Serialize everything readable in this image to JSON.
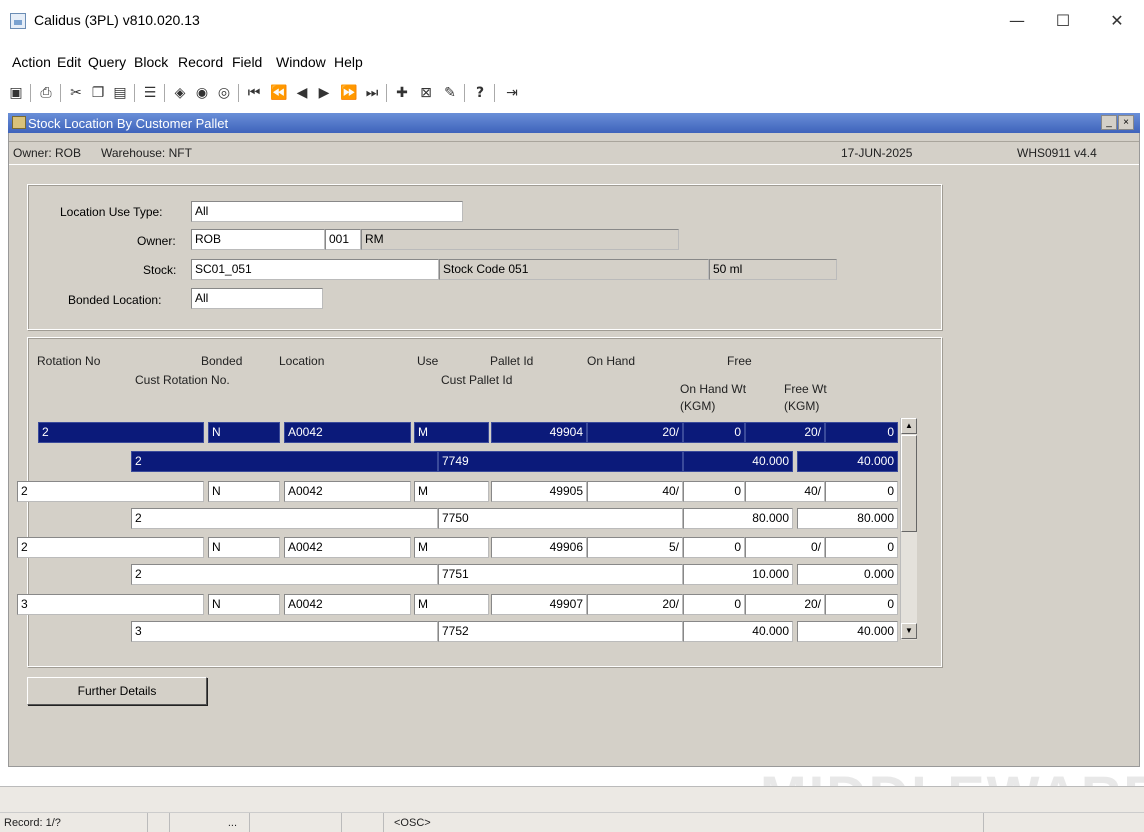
{
  "window": {
    "title": "Calidus (3PL) v810.020.13",
    "minimize": "—",
    "maximize": "☐",
    "close": "✕"
  },
  "menu": [
    {
      "label": "Action"
    },
    {
      "label": "Edit"
    },
    {
      "label": "Query"
    },
    {
      "label": "Block"
    },
    {
      "label": "Record"
    },
    {
      "label": "Field"
    },
    {
      "label": "Window"
    },
    {
      "label": "Help"
    }
  ],
  "toolbar_icons": [
    "save-icon",
    "print-icon",
    "cut-icon",
    "copy-icon",
    "paste-icon",
    "list-icon",
    "clear-block-icon",
    "clear-record-icon",
    "clear-field-icon",
    "first-record-icon",
    "prev-set-icon",
    "prev-record-icon",
    "next-record-icon",
    "next-set-icon",
    "last-record-icon",
    "insert-record-icon",
    "delete-record-icon",
    "duplicate-icon",
    "help-icon",
    "exit-icon"
  ],
  "form": {
    "title": "Stock Location By Customer Pallet",
    "owner_label": "Owner: ROB",
    "warehouse_label": "Warehouse: NFT",
    "date": "17-JUN-2025",
    "screen_id": "WHS0911 v4.4"
  },
  "criteria": {
    "location_use_type_label": "Location Use Type:",
    "location_use_type": "All",
    "owner_label": "Owner:",
    "owner": "ROB",
    "owner_code": "001",
    "owner_name": "RM",
    "stock_label": "Stock:",
    "stock": "SC01_051",
    "stock_desc": "Stock Code 051",
    "stock_size": "50 ml",
    "bonded_location_label": "Bonded Location:",
    "bonded_location": "All"
  },
  "grid": {
    "headers": {
      "rotation_no": "Rotation No",
      "bonded": "Bonded",
      "location": "Location",
      "use": "Use",
      "pallet_id": "Pallet Id",
      "on_hand": "On Hand",
      "free": "Free",
      "cust_rotation_no": "Cust Rotation No.",
      "cust_pallet_id": "Cust Pallet Id",
      "on_hand_wt": "On Hand Wt",
      "on_hand_wt_unit": "(KGM)",
      "free_wt": "Free Wt",
      "free_wt_unit": "(KGM)"
    },
    "rows": [
      {
        "rotation": "2",
        "bonded": "N",
        "location": "A0042",
        "use": "M",
        "pallet_id": "49904",
        "on_hand": "20/",
        "on_hand_2": "0",
        "free": "20/",
        "free_2": "0",
        "cust_rotation": "2",
        "cust_pallet": "7749",
        "on_hand_wt": "40.000",
        "free_wt": "40.000"
      },
      {
        "rotation": "2",
        "bonded": "N",
        "location": "A0042",
        "use": "M",
        "pallet_id": "49905",
        "on_hand": "40/",
        "on_hand_2": "0",
        "free": "40/",
        "free_2": "0",
        "cust_rotation": "2",
        "cust_pallet": "7750",
        "on_hand_wt": "80.000",
        "free_wt": "80.000"
      },
      {
        "rotation": "2",
        "bonded": "N",
        "location": "A0042",
        "use": "M",
        "pallet_id": "49906",
        "on_hand": "5/",
        "on_hand_2": "0",
        "free": "0/",
        "free_2": "0",
        "cust_rotation": "2",
        "cust_pallet": "7751",
        "on_hand_wt": "10.000",
        "free_wt": "0.000"
      },
      {
        "rotation": "3",
        "bonded": "N",
        "location": "A0042",
        "use": "M",
        "pallet_id": "49907",
        "on_hand": "20/",
        "on_hand_2": "0",
        "free": "20/",
        "free_2": "0",
        "cust_rotation": "3",
        "cust_pallet": "7752",
        "on_hand_wt": "40.000",
        "free_wt": "40.000"
      }
    ]
  },
  "buttons": {
    "further_details": "Further Details"
  },
  "status": {
    "record": "Record: 1/?",
    "list": "...",
    "mode": "<OSC>"
  },
  "watermark": "MIDDLEWARE",
  "colors": {
    "selected_row": "#0b1a7a",
    "form_bg": "#d4d0c8",
    "title_bar": "#3e63bb"
  }
}
